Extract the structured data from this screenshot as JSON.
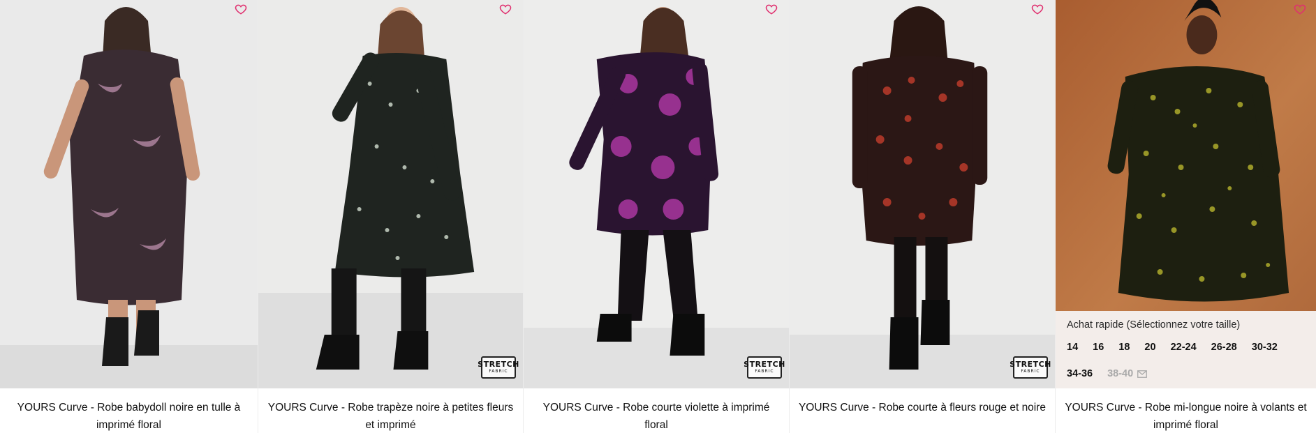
{
  "products": [
    {
      "title": "YOURS Curve - Robe babydoll noire en tulle à imprimé floral",
      "has_stretch_badge": false,
      "colors": {
        "bg": "#e9e9e8",
        "dress": "#3a2c33",
        "accent": "#b58aa5"
      }
    },
    {
      "title": "YOURS Curve - Robe trapèze noire à petites fleurs et imprimé",
      "has_stretch_badge": true,
      "colors": {
        "bg": "#ebebea",
        "dress": "#1f2420",
        "accent": "#c9d3c6"
      }
    },
    {
      "title": "YOURS Curve - Robe courte violette à imprimé floral",
      "has_stretch_badge": true,
      "colors": {
        "bg": "#ededec",
        "dress": "#2a1430",
        "accent": "#a3359a"
      }
    },
    {
      "title": "YOURS Curve - Robe courte à fleurs rouge et noire",
      "has_stretch_badge": true,
      "colors": {
        "bg": "#ececeb",
        "dress": "#2b1715",
        "accent": "#b3392a"
      }
    },
    {
      "title": "YOURS Curve - Robe mi-longue noire à volants et imprimé floral",
      "has_stretch_badge": false,
      "colors": {
        "bg": "#b86d3c",
        "dress": "#1d1f10",
        "accent": "#a6a32a"
      }
    }
  ],
  "stretch_badge": {
    "line1": "STRETCH",
    "line2": "FABRIC"
  },
  "quick_buy": {
    "label": "Achat rapide (Sélectionnez votre taille)",
    "sizes": [
      "14",
      "16",
      "18",
      "20",
      "22-24",
      "26-28",
      "30-32",
      "34-36"
    ],
    "out_of_stock_size": "38-40"
  },
  "icons": {
    "wishlist": "heart-outline-icon",
    "notify": "envelope-icon"
  },
  "accent_color": "#e0306f"
}
